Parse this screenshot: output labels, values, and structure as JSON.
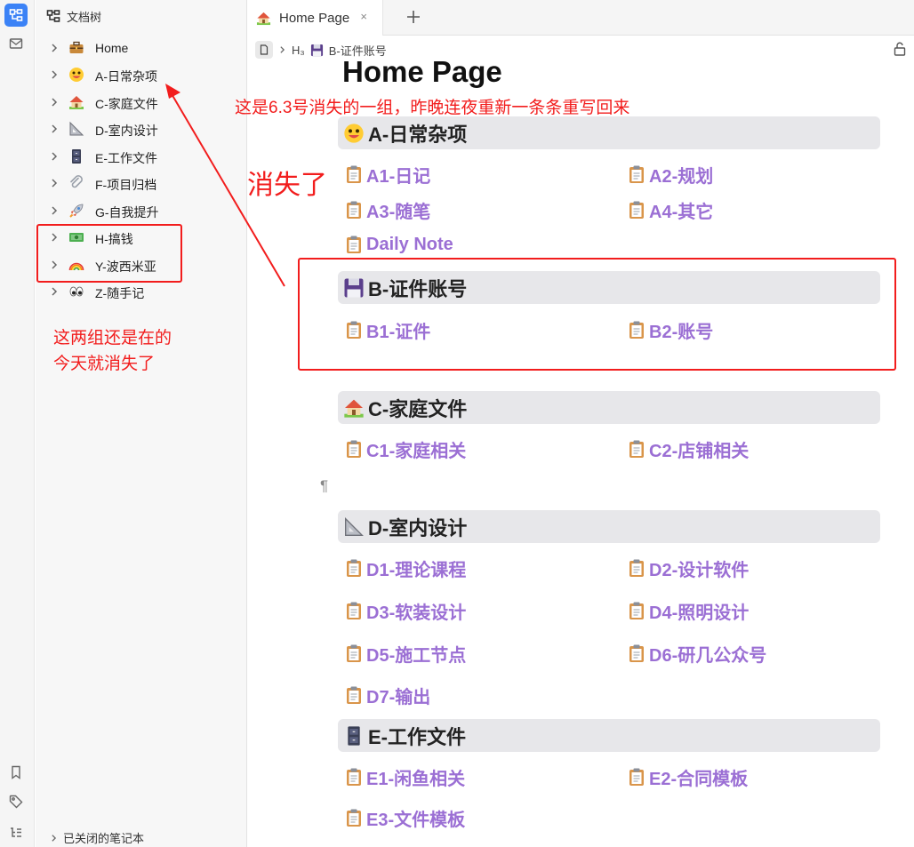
{
  "rail": {
    "top_icons": [
      "doc-tree-icon",
      "inbox-icon"
    ],
    "bottom_icons": [
      "bookmark-icon",
      "tag-icon",
      "outline-icon"
    ]
  },
  "tree": {
    "header_label": "文档树",
    "items": [
      {
        "label": "Home",
        "icon": "briefcase-icon"
      },
      {
        "label": "A-日常杂项",
        "icon": "grinning-face-icon"
      },
      {
        "label": "C-家庭文件",
        "icon": "house-icon"
      },
      {
        "label": "D-室内设计",
        "icon": "triangle-ruler-icon"
      },
      {
        "label": "E-工作文件",
        "icon": "filing-cabinet-icon"
      },
      {
        "label": "F-项目归档",
        "icon": "paperclip-icon"
      },
      {
        "label": "G-自我提升",
        "icon": "rocket-icon"
      },
      {
        "label": "H-搞钱",
        "icon": "money-icon"
      },
      {
        "label": "Y-波西米亚",
        "icon": "rainbow-icon"
      },
      {
        "label": "Z-随手记",
        "icon": "eyes-icon"
      }
    ],
    "closed_notebooks_label": "已关闭的笔记本"
  },
  "tabs": [
    {
      "label": "Home Page",
      "icon": "house-icon",
      "close_glyph": "×"
    }
  ],
  "tab_add_glyph": "+",
  "breadcrumb": {
    "heading_level": "H₃",
    "label": "B-证件账号"
  },
  "page": {
    "title": "Home Page",
    "sections": [
      {
        "heading": "A-日常杂项",
        "icon": "grinning-face-icon",
        "links": [
          "A1-日记",
          "A2-规划",
          "A3-随笔",
          "A4-其它",
          "Daily Note"
        ]
      },
      {
        "heading": "B-证件账号",
        "icon": "floppy-disk-icon",
        "links": [
          "B1-证件",
          "B2-账号"
        ]
      },
      {
        "heading": "C-家庭文件",
        "icon": "house-icon",
        "links": [
          "C1-家庭相关",
          "C2-店铺相关"
        ]
      },
      {
        "heading": "D-室内设计",
        "icon": "triangle-ruler-icon",
        "links": [
          "D1-理论课程",
          "D2-设计软件",
          "D3-软装设计",
          "D4-照明设计",
          "D5-施工节点",
          "D6-研几公众号",
          "D7-输出"
        ]
      },
      {
        "heading": "E-工作文件",
        "icon": "filing-cabinet-icon",
        "links": [
          "E1-闲鱼相关",
          "E2-合同模板",
          "E3-文件模板"
        ]
      }
    ],
    "pilcrow": "¶"
  },
  "annotations": {
    "top_note": "这是6.3号消失的一组，昨晚连夜重新一条条重写回来",
    "vanished": "消失了",
    "left_note_line1": "这两组还是在的",
    "left_note_line2": "今天就消失了"
  },
  "colors": {
    "annotation": "#f21d1d",
    "link": "#9b6fd4",
    "heading_bar": "#e7e7ea",
    "rail_active": "#3b82f6"
  }
}
